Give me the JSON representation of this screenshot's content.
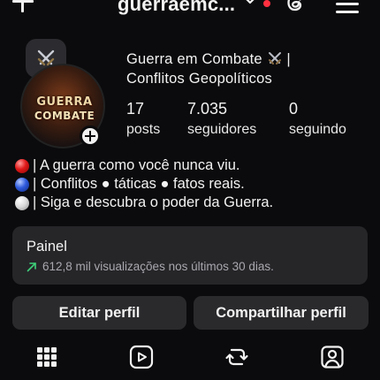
{
  "header": {
    "username": "guerraemc...",
    "notification_color": "#ff3040"
  },
  "profile": {
    "display_name_line1": "Guerra em Combate ⚔️ |",
    "display_name_line1_text": "Guerra em Combate",
    "display_name_line1_suffix": "|",
    "display_name_line2": "Conflitos Geopolíticos",
    "avatar_text_line1": "GUERRA",
    "avatar_text_line2": "COMBATE",
    "stats": [
      {
        "value": "17",
        "label": "posts"
      },
      {
        "value": "7.035",
        "label": "seguidores"
      },
      {
        "value": "0",
        "label": "seguindo"
      }
    ],
    "bio": [
      {
        "ball": "red",
        "text": "| A guerra como você nunca viu."
      },
      {
        "ball": "blue",
        "text": "| Conflitos ● táticas ● fatos reais."
      },
      {
        "ball": "white",
        "text": "| Siga e descubra o poder da Guerra."
      }
    ]
  },
  "dashboard": {
    "title": "Painel",
    "subtitle": "612,8 mil visualizações nos últimos 30 dias.",
    "trend_color": "#3fd17a"
  },
  "buttons": {
    "edit_profile": "Editar perfil",
    "share_profile": "Compartilhar perfil"
  },
  "tabs": [
    {
      "icon": "grid-icon"
    },
    {
      "icon": "reels-icon"
    },
    {
      "icon": "reposts-icon"
    },
    {
      "icon": "tagged-icon"
    }
  ],
  "icons": {
    "top_left": "plus-icon",
    "dropdown": "chevron-down-icon",
    "threads": "threads-icon",
    "menu": "hamburger-menu-icon",
    "note": "swords-icon"
  }
}
